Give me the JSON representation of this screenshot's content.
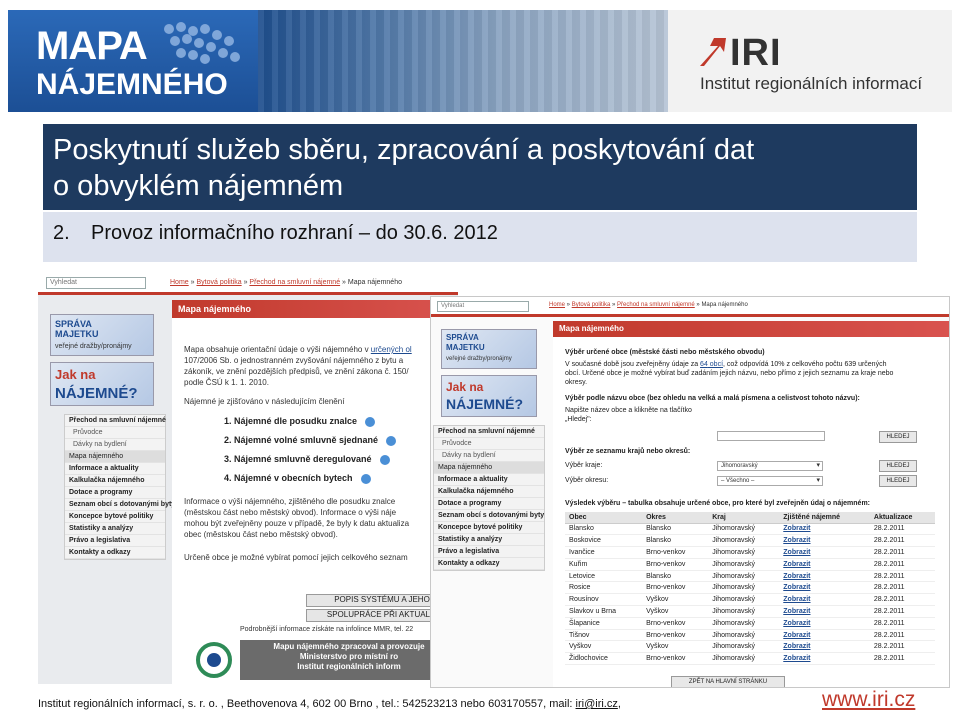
{
  "banner": {
    "mapa_line1": "MAPA",
    "mapa_line2": "NÁJEMNÉHO",
    "iri_mark": "IRI",
    "iri_name": "Institut regionálních informací"
  },
  "title": {
    "line1": "Poskytnutí služeb sběru, zpracování a poskytování dat",
    "line2": "o obvyklém nájemném"
  },
  "subtitle": {
    "number": "2.",
    "text": "Provoz informačního rozhraní – do 30.6. 2012"
  },
  "back_shot": {
    "search_placeholder": "Vyhledat",
    "breadcrumb": [
      "Home",
      "Bytová politika",
      "Přechod na smluvní nájemné",
      "Mapa nájemného"
    ],
    "logo1_line1": "SPRÁVA",
    "logo1_line2": "MAJETKU",
    "logo1_line3": "veřejné dražby/pronájmy",
    "logo2_line1": "Jak na",
    "logo2_line2": "NÁJEMNÉ?",
    "menu": [
      {
        "label": "Přechod na smluvní nájemné",
        "style": "bold"
      },
      {
        "label": "Průvodce",
        "style": "sub"
      },
      {
        "label": "Dávky na bydlení",
        "style": "sub"
      },
      {
        "label": "Mapa nájemného",
        "style": "hl"
      },
      {
        "label": "Informace a aktuality",
        "style": "bold"
      },
      {
        "label": "Kalkulačka nájemného",
        "style": "bold"
      },
      {
        "label": "Dotace a programy",
        "style": "bold"
      },
      {
        "label": "Seznam obcí s dotovanými byty",
        "style": "bold"
      },
      {
        "label": "Koncepce bytové politiky",
        "style": "bold"
      },
      {
        "label": "Statistiky a analýzy",
        "style": "bold"
      },
      {
        "label": "Právo a legislativa",
        "style": "bold"
      },
      {
        "label": "Kontakty a odkazy",
        "style": "bold"
      }
    ],
    "panel_title": "Mapa nájemného",
    "intro_1": "Mapa obsahuje orientační údaje o výši nájemného v ",
    "intro_link": "určených ol",
    "intro_2": "107/2006 Sb. o jednostranném zvyšování nájemného z bytu a",
    "intro_3": "zákoník, ve znění pozdějších předpisů, ve znění zákona č. 150/",
    "intro_4": "podle ČSÚ k 1. 1. 2010.",
    "intro_5": "Nájemné je zjišťováno v následujícím členění",
    "bullets": [
      "1. Nájemné dle posudku znalce",
      "2. Nájemné volné smluvně sjednané",
      "3. Nájemné smluvně deregulované",
      "4. Nájemné v obecních bytech"
    ],
    "info_1": "Informace o výši nájemného, zjištěného dle posudku znalce",
    "info_2": "(městskou část nebo městský obvod). Informace o výši náje",
    "info_3": "mohou být zveřejněny pouze v případě, že byly k datu aktualiza",
    "info_4": "obec (městskou část nebo městský obvod).",
    "choose_text": "Určeně obce je možné vybírat pomocí jejich celkového seznam",
    "btn_popis": "POPIS SYSTÉMU A JEHO",
    "btn_spoluprace": "SPOLUPRÁCE PŘI AKTUALIZ",
    "more_info": "Podrobnější informace získáte na infolince MMR, tel. 22",
    "mmr_1": "Mapu nájemného zpracoval a provozuje",
    "mmr_2": "Ministerstvo pro místní ro",
    "mmr_3": "Institut regionálních inform"
  },
  "front_shot": {
    "search_placeholder": "Vyhledat",
    "breadcrumb": [
      "Home",
      "Bytová politika",
      "Přechod na smluvní nájemné",
      "Mapa nájemného"
    ],
    "logo1_line1": "SPRÁVA",
    "logo1_line2": "MAJETKU",
    "logo1_line3": "veřejné dražby/pronájmy",
    "logo2_line1": "Jak na",
    "logo2_line2": "NÁJEMNÉ?",
    "menu": [
      {
        "label": "Přechod na smluvní nájemné",
        "style": "bold"
      },
      {
        "label": "Průvodce",
        "style": "sub"
      },
      {
        "label": "Dávky na bydlení",
        "style": "sub"
      },
      {
        "label": "Mapa nájemného",
        "style": "hl"
      },
      {
        "label": "Informace a aktuality",
        "style": "bold"
      },
      {
        "label": "Kalkulačka nájemného",
        "style": "bold"
      },
      {
        "label": "Dotace a programy",
        "style": "bold"
      },
      {
        "label": "Seznam obcí s dotovanými byty",
        "style": "bold"
      },
      {
        "label": "Koncepce bytové politiky",
        "style": "bold"
      },
      {
        "label": "Statistiky a analýzy",
        "style": "bold"
      },
      {
        "label": "Právo a legislativa",
        "style": "bold"
      },
      {
        "label": "Kontakty a odkazy",
        "style": "bold"
      }
    ],
    "panel_title": "Mapa nájemného",
    "section1_title": "Výběr určené obce (městské části nebo městského obvodu)",
    "section1_l1a": "V současné době jsou zveřejněny údaje za ",
    "section1_count": "64",
    "section1_l1b": " obcí",
    "section1_l1c": ", což odpovídá 10% z celkového počtu 639 určených",
    "section1_l2": "obcí. Určené obce je možné vybírat buď zadáním jejich názvu, nebo přímo z jejich seznamu za kraje nebo",
    "section1_l3": "okresy.",
    "section2_title": "Výběr podle názvu obce (bez ohledu na velká a malá písmena a celistvost tohoto názvu):",
    "section2_l1": "Napište název obce a klikněte na tlačítko",
    "section2_l2": "„Hledej\":",
    "btn_hledej": "HLEDEJ",
    "section3_title": "Výběr ze seznamu krajů nebo okresů:",
    "label_kraj": "Výběr kraje:",
    "kraj_value": "Jihomoravský",
    "label_okres": "Výběr okresu:",
    "okres_value": "– Všechno –",
    "result_title": "Výsledek výběru – tabulka obsahuje určené obce, pro které byl zveřejněn údaj o nájemném:",
    "table_headers": [
      "Obec",
      "Okres",
      "Kraj",
      "Zjištěné nájemné",
      "Aktualizace"
    ],
    "table_rows": [
      [
        "Blansko",
        "Blansko",
        "Jihomoravský",
        "Zobrazit",
        "28.2.2011"
      ],
      [
        "Boskovice",
        "Blansko",
        "Jihomoravský",
        "Zobrazit",
        "28.2.2011"
      ],
      [
        "Ivančice",
        "Brno-venkov",
        "Jihomoravský",
        "Zobrazit",
        "28.2.2011"
      ],
      [
        "Kuřim",
        "Brno-venkov",
        "Jihomoravský",
        "Zobrazit",
        "28.2.2011"
      ],
      [
        "Letovice",
        "Blansko",
        "Jihomoravský",
        "Zobrazit",
        "28.2.2011"
      ],
      [
        "Rosice",
        "Brno-venkov",
        "Jihomoravský",
        "Zobrazit",
        "28.2.2011"
      ],
      [
        "Rousínov",
        "Vyškov",
        "Jihomoravský",
        "Zobrazit",
        "28.2.2011"
      ],
      [
        "Slavkov u Brna",
        "Vyškov",
        "Jihomoravský",
        "Zobrazit",
        "28.2.2011"
      ],
      [
        "Šlapanice",
        "Brno-venkov",
        "Jihomoravský",
        "Zobrazit",
        "28.2.2011"
      ],
      [
        "Tišnov",
        "Brno-venkov",
        "Jihomoravský",
        "Zobrazit",
        "28.2.2011"
      ],
      [
        "Vyškov",
        "Vyškov",
        "Jihomoravský",
        "Zobrazit",
        "28.2.2011"
      ],
      [
        "Židlochovice",
        "Brno-venkov",
        "Jihomoravský",
        "Zobrazit",
        "28.2.2011"
      ]
    ],
    "btn_back": "ZPĚT NA HLAVNÍ STRÁNKU"
  },
  "footer": {
    "address": "Institut regionálních informací, s. r. o. , Beethovenova  4, 602 00 Brno , tel.: 542523213  nebo  603170557,  mail: ",
    "mail": "iri@iri.cz",
    "trail": ",",
    "url": "www.iri.cz"
  },
  "colors": {
    "title_band": "#1e3a5f",
    "subtitle_band": "#dde2ee",
    "accent_red": "#c0392b",
    "mapa_blue": "#1f5aa6"
  }
}
